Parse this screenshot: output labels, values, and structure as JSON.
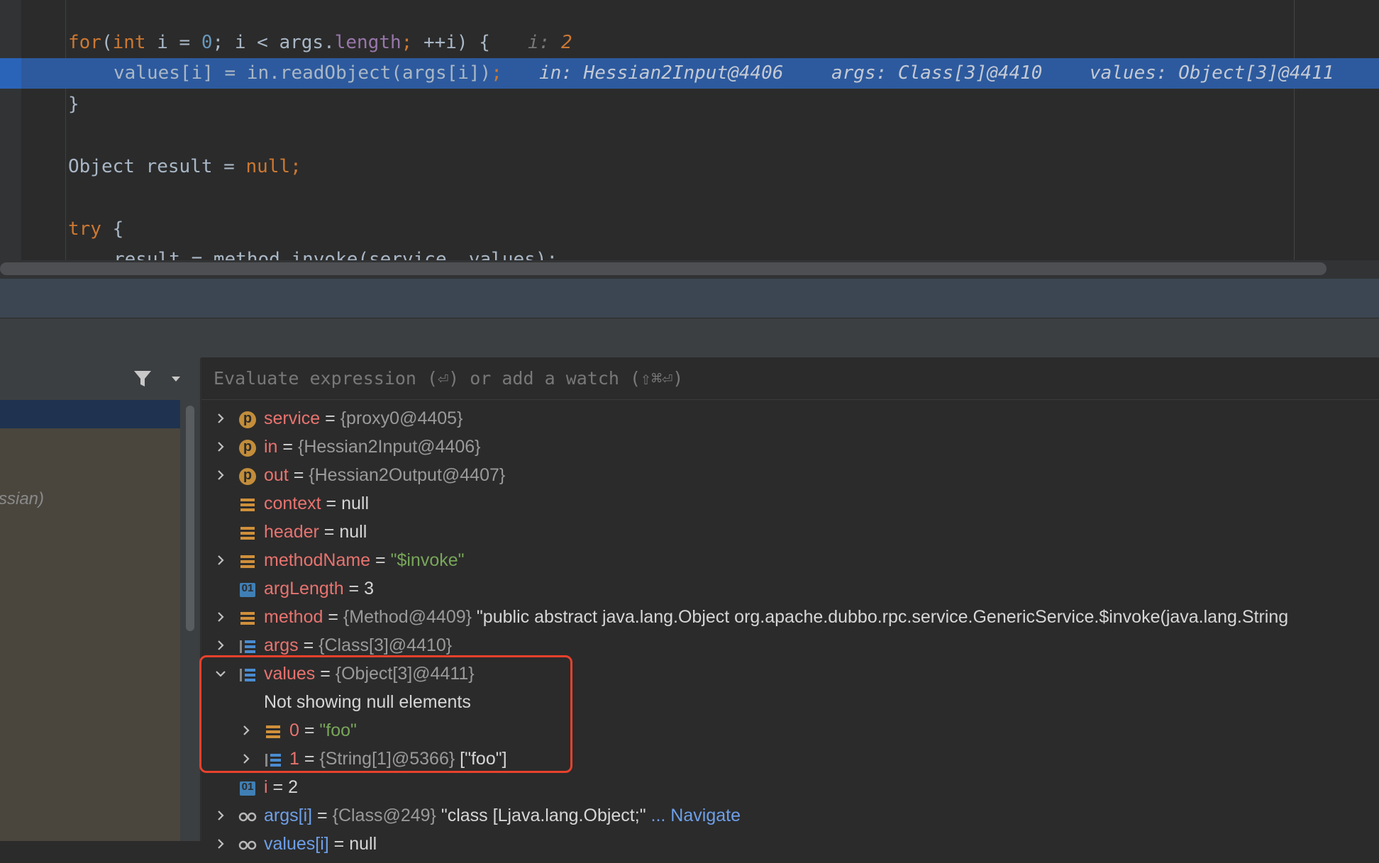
{
  "editor": {
    "line1": {
      "kw_for": "for",
      "paren_open": "(",
      "kw_int": "int",
      "mid1": " i = ",
      "zero": "0",
      "mid2": "; i < args.",
      "length": "length",
      "semi": ";",
      "tail": " ++i) {",
      "hint_label": "i: ",
      "hint_value": "2"
    },
    "line2": {
      "code": "values[i] = in.readObject(args[i])",
      "semi": ";",
      "hint1": "in: Hessian2Input@4406",
      "hint2": "args: Class[3]@4410",
      "hint3": "values: Object[3]@4411"
    },
    "line3": {
      "code": "}"
    },
    "line4": {
      "code": "Object result = ",
      "null_kw": "null",
      "semi": ";"
    },
    "line5": {
      "kw_try": "try",
      "tail": " {"
    },
    "line6": {
      "code": "result = method.invoke(service, values);"
    }
  },
  "frames": {
    "visible_text": "ssian)"
  },
  "variables": {
    "eval_placeholder": "Evaluate expression (⏎) or add a watch (⇧⌘⏎)",
    "rows": [
      {
        "name": "service",
        "eq": " = ",
        "value": "{proxy0@4405}",
        "icon": "parameter-icon",
        "icon_text": "p"
      },
      {
        "name": "in",
        "eq": " = ",
        "value": "{Hessian2Input@4406}",
        "icon": "parameter-icon",
        "icon_text": "p"
      },
      {
        "name": "out",
        "eq": " = ",
        "value": "{Hessian2Output@4407}",
        "icon": "parameter-icon",
        "icon_text": "p"
      },
      {
        "name": "context",
        "eq": " = ",
        "value": "null",
        "icon": "field-icon"
      },
      {
        "name": "header",
        "eq": " = ",
        "value": "null",
        "icon": "field-icon"
      },
      {
        "name": "methodName",
        "eq": " = ",
        "value": "\"$invoke\"",
        "icon": "field-icon"
      },
      {
        "name": "argLength",
        "eq": " = ",
        "value": "3",
        "icon": "primitive-icon",
        "icon_text": "01"
      },
      {
        "name": "method",
        "eq": " = ",
        "value": "{Method@4409}",
        "extra": " \"public abstract java.lang.Object org.apache.dubbo.rpc.service.GenericService.$invoke(java.lang.String",
        "icon": "field-icon"
      },
      {
        "name": "args",
        "eq": " = ",
        "value": "{Class[3]@4410}",
        "icon": "array-icon"
      },
      {
        "name": "values",
        "eq": " = ",
        "value": "{Object[3]@4411}",
        "icon": "array-icon"
      },
      {
        "message": "Not showing null elements"
      },
      {
        "name": "0",
        "eq": " = ",
        "value": "\"foo\"",
        "icon": "field-icon"
      },
      {
        "name": "1",
        "eq": " = ",
        "value": "{String[1]@5366}",
        "extra": " [\"foo\"]",
        "icon": "array-icon"
      },
      {
        "name": "i",
        "eq": " = ",
        "value": "2",
        "icon": "primitive-icon",
        "icon_text": "01"
      },
      {
        "name": "args[i]",
        "eq": " = ",
        "value": "{Class@249}",
        "extra": " \"class [Ljava.lang.Object;\"",
        "link": " ... Navigate",
        "icon": "watch-icon"
      },
      {
        "name": "values[i]",
        "eq": " = ",
        "value": "null",
        "icon": "watch-icon"
      }
    ]
  },
  "colors": {
    "highlight_box": "#e8412c",
    "current_line": "#2d5a9e"
  }
}
